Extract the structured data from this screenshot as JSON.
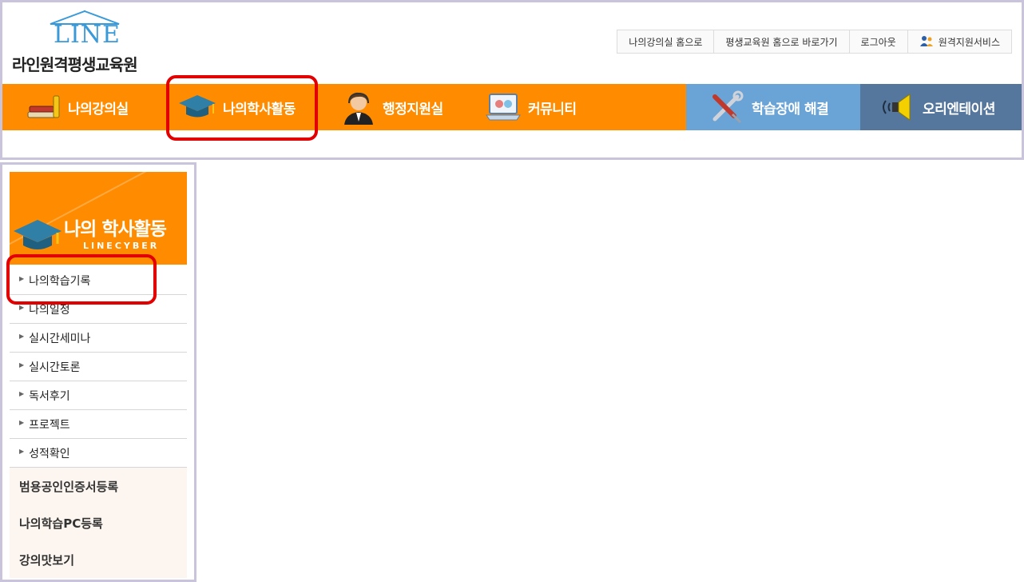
{
  "brand": {
    "logo_mark": "LINE",
    "name": "라인원격평생교육원",
    "accent_color": "#3a9ad9"
  },
  "util_links": [
    {
      "label": "나의강의실 홈으로"
    },
    {
      "label": "평생교육원 홈으로 바로가기"
    },
    {
      "label": "로그아웃"
    },
    {
      "label": "원격지원서비스",
      "icon": "people-icon"
    }
  ],
  "main_nav": {
    "color": "#ff8c00",
    "items": [
      {
        "label": "나의강의실",
        "icon": "books-icon"
      },
      {
        "label": "나의학사활동",
        "icon": "graduation-cap-icon"
      },
      {
        "label": "행정지원실",
        "icon": "person-headset-icon"
      },
      {
        "label": "커뮤니티",
        "icon": "laptop-chat-icon"
      },
      {
        "label": "학습장애 해결",
        "icon": "tools-icon",
        "color": "#6aa3d6"
      },
      {
        "label": "오리엔테이션",
        "icon": "speaker-icon",
        "color": "#56779d"
      }
    ]
  },
  "sidebar": {
    "banner_title": "나의 학사활동",
    "banner_sub": "LINECYBER",
    "items": [
      {
        "label": "나의학습기록"
      },
      {
        "label": "나의일정"
      },
      {
        "label": "실시간세미나"
      },
      {
        "label": "실시간토론"
      },
      {
        "label": "독서후기"
      },
      {
        "label": "프로젝트"
      },
      {
        "label": "성적확인"
      }
    ],
    "extra": [
      {
        "label": "범용공인인증서등록"
      },
      {
        "label": "나의학습PC등록"
      },
      {
        "label": "강의맛보기"
      }
    ]
  },
  "highlight_color": "#e30000"
}
